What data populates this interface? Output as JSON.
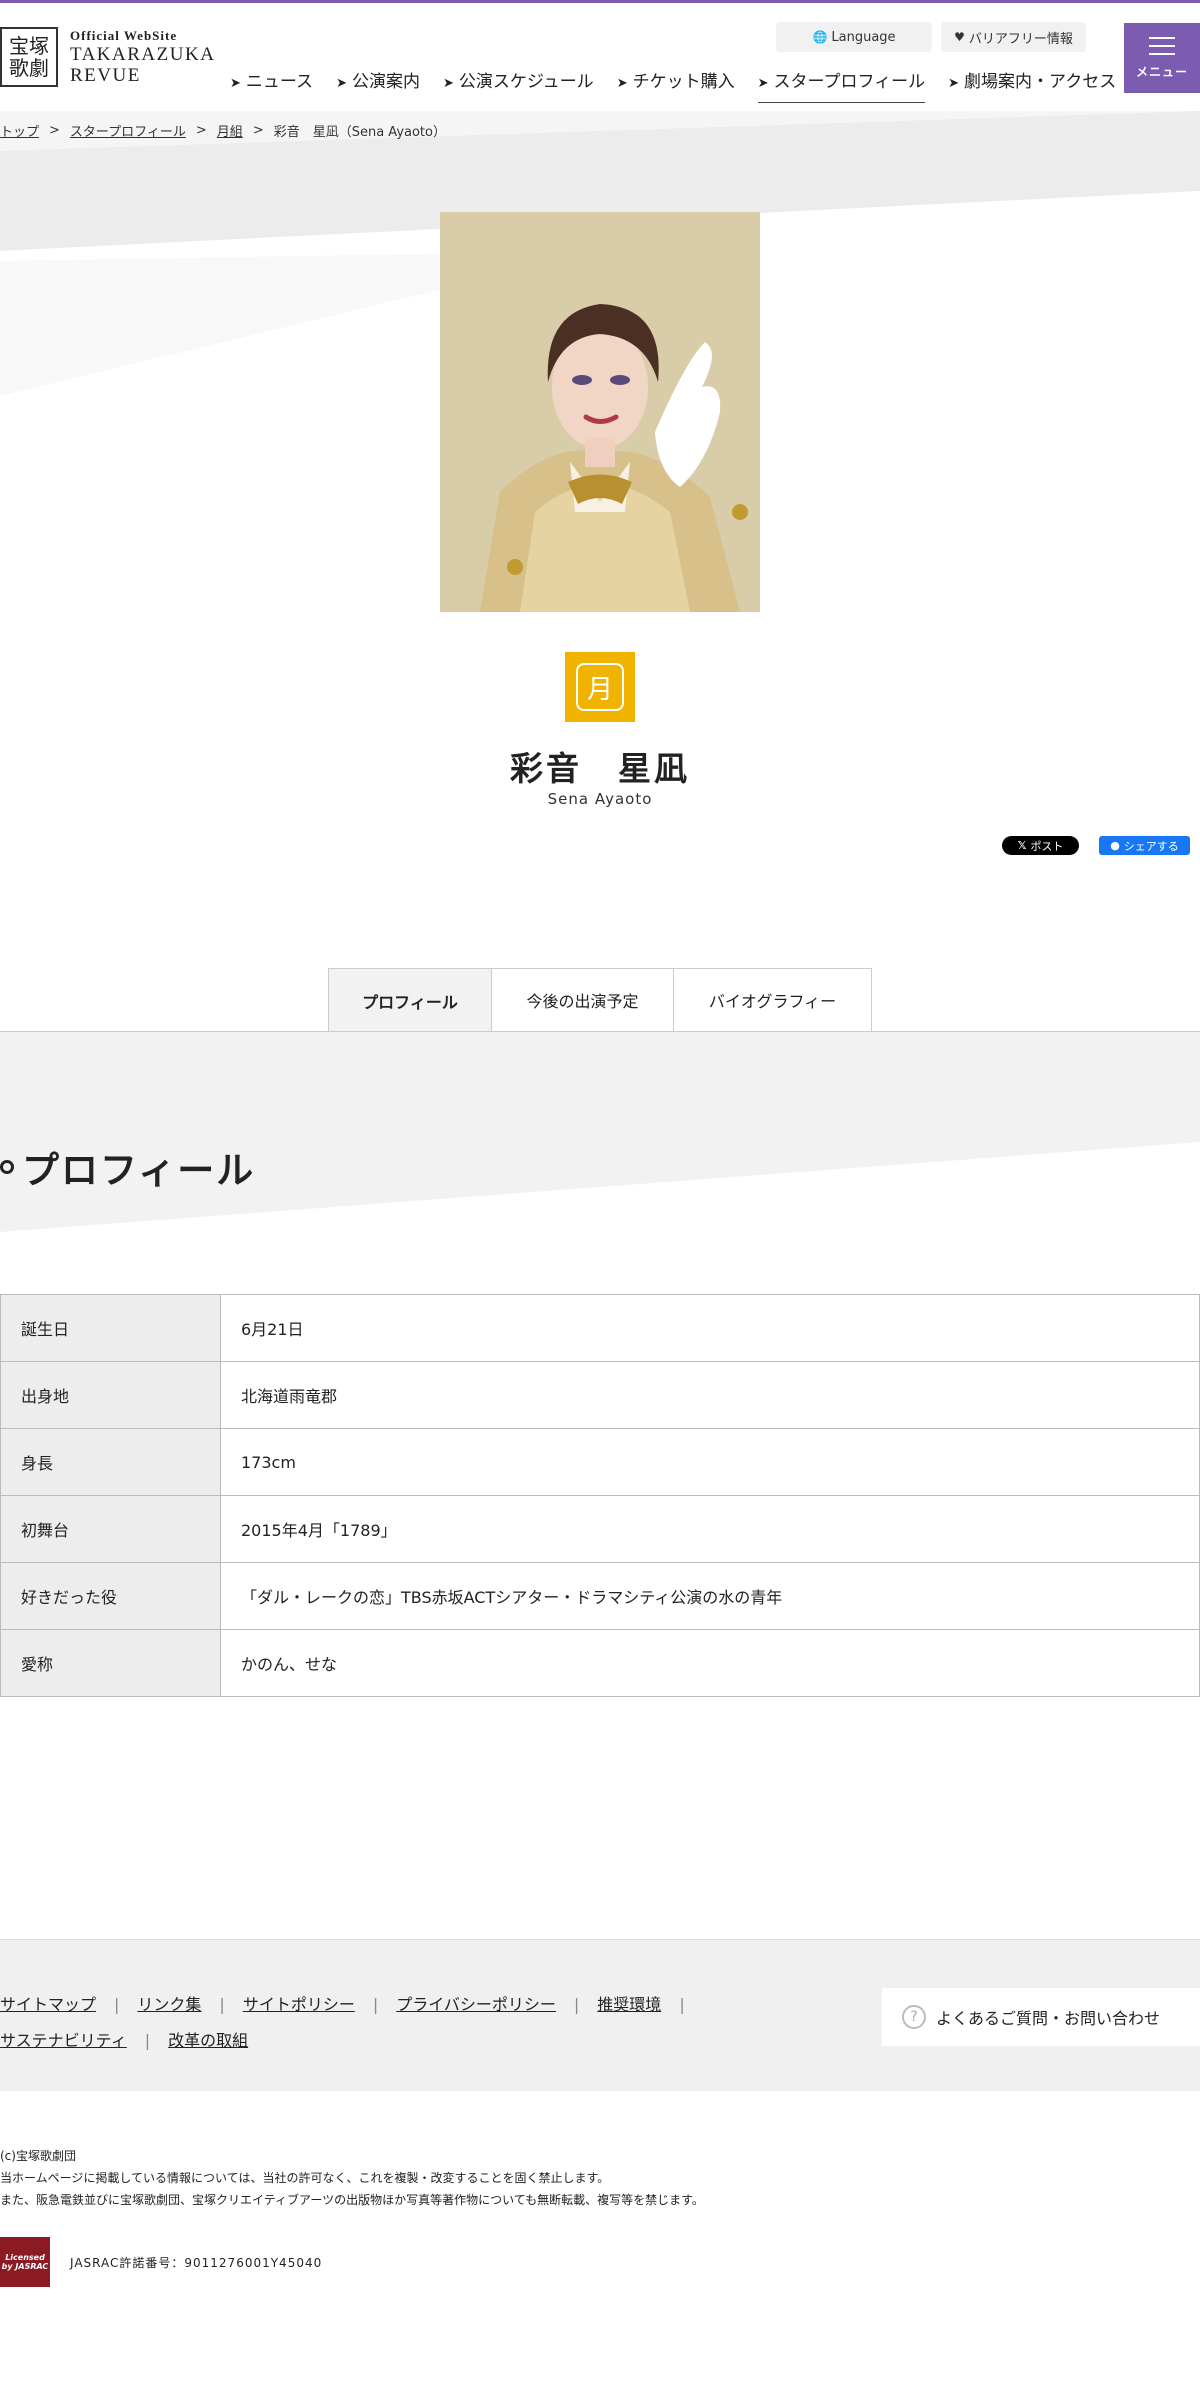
{
  "header": {
    "logo_mark": "宝塚歌劇",
    "logo_small": "Official WebSite",
    "logo_line1": "TAKARAZUKA",
    "logo_line2": "REVUE",
    "language_label": "Language",
    "barrier_free_label": "バリアフリー情報",
    "menu_label": "メニュー",
    "nav": [
      {
        "label": "ニュース"
      },
      {
        "label": "公演案内"
      },
      {
        "label": "公演スケジュール"
      },
      {
        "label": "チケット購入"
      },
      {
        "label": "スタープロフィール"
      },
      {
        "label": "劇場案内・アクセス"
      }
    ]
  },
  "breadcrumb": {
    "items": [
      "トップ",
      "スタープロフィール",
      "月組"
    ],
    "current": "彩音　星凪（Sena Ayaoto）"
  },
  "star": {
    "troupe_icon": "月",
    "name": "彩音　星凪",
    "name_en": "Sena Ayaoto"
  },
  "share": {
    "x_label": "ポスト",
    "fb_label": "シェアする"
  },
  "tabs": [
    {
      "label": "プロフィール",
      "active": true
    },
    {
      "label": "今後の出演予定",
      "active": false
    },
    {
      "label": "バイオグラフィー",
      "active": false
    }
  ],
  "section": {
    "title": "プロフィール"
  },
  "profile": [
    {
      "key": "誕生日",
      "value": "6月21日"
    },
    {
      "key": "出身地",
      "value": "北海道雨竜郡"
    },
    {
      "key": "身長",
      "value": "173cm"
    },
    {
      "key": "初舞台",
      "value": "2015年4月「1789」"
    },
    {
      "key": "好きだった役",
      "value": "「ダル・レークの恋」TBS赤坂ACTシアター・ドラマシティ公演の水の青年"
    },
    {
      "key": "愛称",
      "value": "かのん、せな"
    }
  ],
  "footer": {
    "links_row1": [
      "サイトマップ",
      "リンク集",
      "サイトポリシー",
      "プライバシーポリシー",
      "推奨環境"
    ],
    "links_row2": [
      "サステナビリティ",
      "改革の取組"
    ],
    "faq_label": "よくあるご質問・お問い合わせ",
    "copyright": "(c)宝塚歌劇団",
    "notice1": "当ホームページに掲載している情報については、当社の許可なく、これを複製・改変することを固く禁止します。",
    "notice2": "また、阪急電鉄並びに宝塚歌劇団、宝塚クリエイティブアーツの出版物ほか写真等著作物についても無断転載、複写等を禁じます。",
    "jasrac_logo": "Licensed by JASRAC",
    "jasrac_number": "JASRAC許諾番号：9011276001Y45040"
  },
  "colors": {
    "brand_purple": "#7b5cb0",
    "troupe_yellow": "#f0b400",
    "fb_blue": "#1877f2",
    "jasrac_red": "#8b1a23"
  }
}
